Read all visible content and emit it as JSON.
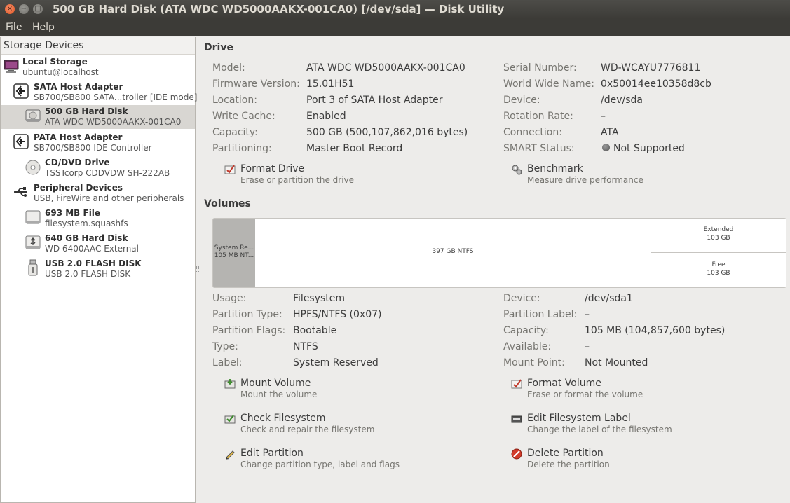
{
  "window": {
    "title": "500 GB Hard Disk (ATA WDC WD5000AAKX-001CA0) [/dev/sda] — Disk Utility",
    "close_glyph": "×",
    "min_glyph": "−",
    "max_glyph": "□"
  },
  "menu": {
    "file": "File",
    "help": "Help"
  },
  "sidebar": {
    "header": "Storage Devices",
    "items": [
      {
        "title": "Local Storage",
        "sub": "ubuntu@localhost",
        "icon": "computer-icon"
      },
      {
        "title": "SATA Host Adapter",
        "sub": "SB700/SB800 SATA...troller [IDE mode]",
        "icon": "host-adapter-icon"
      },
      {
        "title": "500 GB Hard Disk",
        "sub": "ATA WDC WD5000AAKX-001CA0",
        "icon": "hard-disk-icon"
      },
      {
        "title": "PATA Host Adapter",
        "sub": "SB700/SB800 IDE Controller",
        "icon": "host-adapter-icon"
      },
      {
        "title": "CD/DVD Drive",
        "sub": "TSSTcorp CDDVDW SH-222AB",
        "icon": "optical-drive-icon"
      },
      {
        "title": "Peripheral Devices",
        "sub": "USB, FireWire and other peripherals",
        "icon": "usb-icon"
      },
      {
        "title": "693 MB File",
        "sub": "filesystem.squashfs",
        "icon": "disk-image-icon"
      },
      {
        "title": "640 GB Hard Disk",
        "sub": "WD 6400AAC External",
        "icon": "external-disk-icon"
      },
      {
        "title": "USB 2.0 FLASH DISK",
        "sub": "USB 2.0 FLASH DISK",
        "icon": "flash-drive-icon"
      }
    ]
  },
  "drive": {
    "section_title": "Drive",
    "left": [
      {
        "label": "Model:",
        "value": "ATA WDC WD5000AAKX-001CA0"
      },
      {
        "label": "Firmware Version:",
        "value": "15.01H51"
      },
      {
        "label": "Location:",
        "value": "Port 3 of SATA Host Adapter"
      },
      {
        "label": "Write Cache:",
        "value": "Enabled"
      },
      {
        "label": "Capacity:",
        "value": "500 GB (500,107,862,016 bytes)"
      },
      {
        "label": "Partitioning:",
        "value": "Master Boot Record"
      }
    ],
    "right": [
      {
        "label": "Serial Number:",
        "value": "WD-WCAYU7776811"
      },
      {
        "label": "World Wide Name:",
        "value": "0x50014ee10358d8cb"
      },
      {
        "label": "Device:",
        "value": "/dev/sda"
      },
      {
        "label": "Rotation Rate:",
        "value": "–"
      },
      {
        "label": "Connection:",
        "value": "ATA"
      },
      {
        "label": "SMART Status:",
        "value": "Not Supported"
      }
    ],
    "actions": {
      "format": {
        "title": "Format Drive",
        "sub": "Erase or partition the drive"
      },
      "benchmark": {
        "title": "Benchmark",
        "sub": "Measure drive performance"
      }
    }
  },
  "volumes": {
    "section_title": "Volumes",
    "segments": {
      "system": {
        "line1": "System Re...",
        "line2": "105 MB NT..."
      },
      "ntfs": {
        "line1": "397 GB NTFS"
      },
      "extended": {
        "line1": "Extended",
        "line2": "103 GB"
      },
      "free": {
        "line1": "Free",
        "line2": "103 GB"
      }
    },
    "left": [
      {
        "label": "Usage:",
        "value": "Filesystem"
      },
      {
        "label": "Partition Type:",
        "value": "HPFS/NTFS (0x07)"
      },
      {
        "label": "Partition Flags:",
        "value": "Bootable"
      },
      {
        "label": "Type:",
        "value": "NTFS"
      },
      {
        "label": "Label:",
        "value": "System Reserved"
      }
    ],
    "right": [
      {
        "label": "Device:",
        "value": "/dev/sda1"
      },
      {
        "label": "Partition Label:",
        "value": "–"
      },
      {
        "label": "Capacity:",
        "value": "105 MB (104,857,600 bytes)"
      },
      {
        "label": "Available:",
        "value": "–"
      },
      {
        "label": "Mount Point:",
        "value": "Not Mounted"
      }
    ],
    "actions": {
      "mount": {
        "title": "Mount Volume",
        "sub": "Mount the volume"
      },
      "format": {
        "title": "Format Volume",
        "sub": "Erase or format the volume"
      },
      "check": {
        "title": "Check Filesystem",
        "sub": "Check and repair the filesystem"
      },
      "edit_label": {
        "title": "Edit Filesystem Label",
        "sub": "Change the label of the filesystem"
      },
      "edit_partition": {
        "title": "Edit Partition",
        "sub": "Change partition type, label and flags"
      },
      "delete": {
        "title": "Delete Partition",
        "sub": "Delete the partition"
      }
    }
  }
}
